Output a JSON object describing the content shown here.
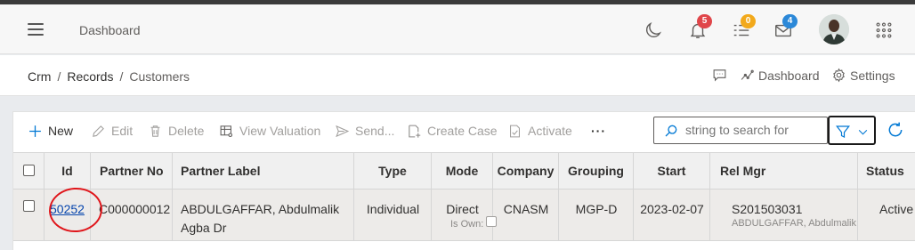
{
  "header": {
    "title": "Dashboard",
    "notifications_count": "5",
    "tasks_count": "0",
    "messages_count": "4",
    "colors": {
      "notif_badge": "#e0464a",
      "tasks_badge": "#f2a91b",
      "messages_badge": "#2b88d8"
    }
  },
  "breadcrumb": {
    "items": [
      "Crm",
      "Records",
      "Customers"
    ],
    "dashboard_label": "Dashboard",
    "settings_label": "Settings"
  },
  "toolbar": {
    "new_label": "New",
    "edit_label": "Edit",
    "delete_label": "Delete",
    "view_valuation_label": "View Valuation",
    "send_label": "Send...",
    "create_case_label": "Create Case",
    "activate_label": "Activate",
    "more_label": "···",
    "search_placeholder": "string to search for"
  },
  "table": {
    "columns": [
      "Id",
      "Partner No",
      "Partner Label",
      "Type",
      "Mode",
      "Company",
      "Grouping",
      "Start",
      "Rel Mgr",
      "Status"
    ],
    "rows": [
      {
        "id": "50252",
        "partner_no": "C000000012",
        "partner_label_line1": "ABDULGAFFAR, Abdulmalik",
        "partner_label_line2": "Agba Dr",
        "type": "Individual",
        "mode": "Direct",
        "is_own_label": "Is Own:",
        "company": "CNASM",
        "grouping": "MGP-D",
        "start": "2023-02-07",
        "rel_mgr": "S201503031",
        "rel_mgr_name": "ABDULGAFFAR, Abdulmalik",
        "status": "Active"
      }
    ]
  },
  "accent_color": "#0078d4"
}
